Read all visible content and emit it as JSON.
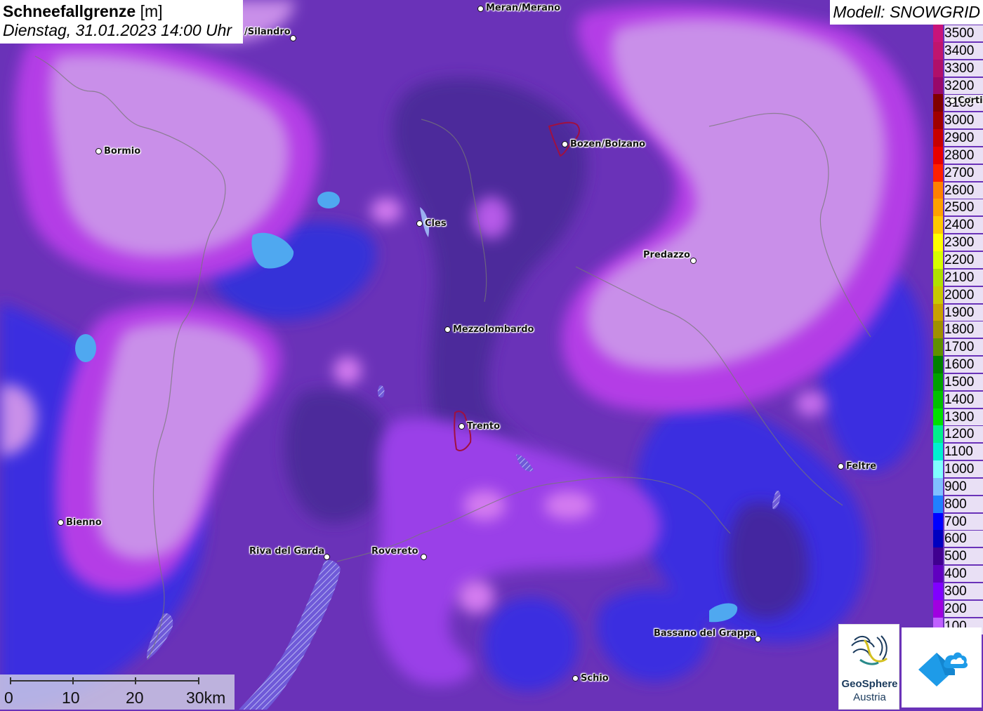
{
  "header": {
    "title": "Schneefallgrenze",
    "unit": "[m]",
    "datetime": "Dienstag, 31.01.2023 14:00 Uhr"
  },
  "model": "Modell: SNOWGRID",
  "legend": [
    {
      "label": "3500",
      "color": "#c8147a"
    },
    {
      "label": "3400",
      "color": "#c0156e"
    },
    {
      "label": "3300",
      "color": "#b0106a"
    },
    {
      "label": "3200",
      "color": "#98086a"
    },
    {
      "label": "3100",
      "color": "#800000"
    },
    {
      "label": "3000",
      "color": "#a00000"
    },
    {
      "label": "2900",
      "color": "#c80000"
    },
    {
      "label": "2800",
      "color": "#e80000"
    },
    {
      "label": "2700",
      "color": "#ff2000"
    },
    {
      "label": "2600",
      "color": "#ff8000"
    },
    {
      "label": "2500",
      "color": "#ffa000"
    },
    {
      "label": "2400",
      "color": "#ffc800"
    },
    {
      "label": "2300",
      "color": "#ffff00"
    },
    {
      "label": "2200",
      "color": "#d8ff00"
    },
    {
      "label": "2100",
      "color": "#b0e000"
    },
    {
      "label": "2000",
      "color": "#c8c800"
    },
    {
      "label": "1900",
      "color": "#c8a000"
    },
    {
      "label": "1800",
      "color": "#a09000"
    },
    {
      "label": "1700",
      "color": "#609000"
    },
    {
      "label": "1600",
      "color": "#008000"
    },
    {
      "label": "1500",
      "color": "#00a000"
    },
    {
      "label": "1400",
      "color": "#00c000"
    },
    {
      "label": "1300",
      "color": "#00e000"
    },
    {
      "label": "1200",
      "color": "#00f08c"
    },
    {
      "label": "1100",
      "color": "#00f0d0"
    },
    {
      "label": "1000",
      "color": "#80ffff"
    },
    {
      "label": "900",
      "color": "#80c0ff"
    },
    {
      "label": "800",
      "color": "#2080ff"
    },
    {
      "label": "700",
      "color": "#0000ff"
    },
    {
      "label": "600",
      "color": "#0000c0"
    },
    {
      "label": "500",
      "color": "#400090"
    },
    {
      "label": "400",
      "color": "#6000c0"
    },
    {
      "label": "300",
      "color": "#8000ff"
    },
    {
      "label": "200",
      "color": "#a000e0"
    },
    {
      "label": "100",
      "color": "#c060ff"
    }
  ],
  "cities": [
    {
      "name": "Meran/Merano"
    },
    {
      "name": "/Silandro"
    },
    {
      "name": "Bormio"
    },
    {
      "name": "Bozen/Bolzano"
    },
    {
      "name": "Cles"
    },
    {
      "name": "Predazzo"
    },
    {
      "name": "Mezzolombardo"
    },
    {
      "name": "Trento"
    },
    {
      "name": "Feltre"
    },
    {
      "name": "Bienno"
    },
    {
      "name": "Riva del Garda"
    },
    {
      "name": "Rovereto"
    },
    {
      "name": "Bassano del Grappa"
    },
    {
      "name": "Schio"
    },
    {
      "name": "Corti"
    }
  ],
  "scale": {
    "labels": [
      "0",
      "10",
      "20",
      "30km"
    ]
  },
  "logos": {
    "geosphere_line1": "GeoSphere",
    "geosphere_line2": "Austria"
  },
  "colors": {
    "base_violet": "#6a32b8",
    "light_lilac": "#c98fe9",
    "magenta_band": "#b43ce6",
    "blue_low": "#3a2ee0",
    "dark_purple": "#4a2a98",
    "light_blue_spot": "#4fa8f0"
  }
}
